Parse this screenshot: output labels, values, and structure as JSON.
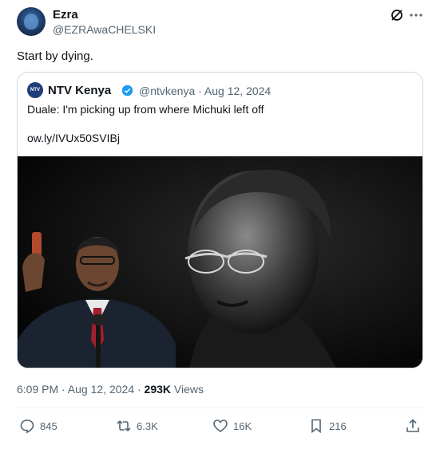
{
  "author": {
    "name": "Ezra",
    "handle": "@EZRAwaCHELSKI"
  },
  "icons": {
    "grok": "grok-icon",
    "more": "more-icon"
  },
  "tweet": {
    "text": "Start by dying."
  },
  "quote": {
    "avatar_text": "NTV",
    "name": "NTV Kenya",
    "meta": "@ntvkenya · Aug 12, 2024",
    "text": "Duale: I'm picking up from where Michuki left off",
    "link": "ow.ly/IVUx50SVIBj"
  },
  "footer": {
    "time": "6:09 PM · Aug 12, 2024 · ",
    "views": "293K",
    "views_label": " Views"
  },
  "actions": {
    "reply": "845",
    "repost": "6.3K",
    "like": "16K",
    "bookmark": "216"
  },
  "colors": {
    "accent": "#1d9bf0",
    "text": "#0f1419",
    "muted": "#536471",
    "border": "#cfd9de"
  }
}
